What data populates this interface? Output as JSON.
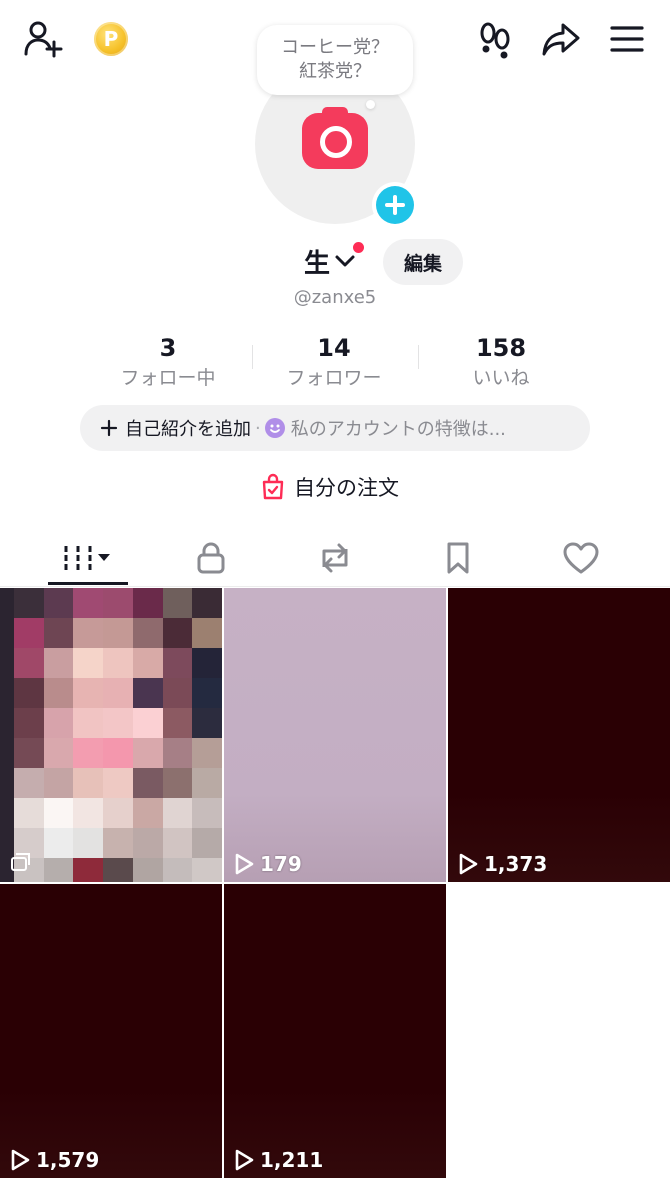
{
  "top_bar": {
    "icons": [
      "add-friend-icon",
      "coin-icon",
      "footprints-icon",
      "share-icon",
      "menu-icon"
    ],
    "coin_letter": "P"
  },
  "bubble": {
    "line1": "コーヒー党？",
    "line2": "紅茶党？"
  },
  "profile": {
    "name": "生",
    "edit_label": "編集",
    "handle": "@zanxe5",
    "accent": "#fe2c55",
    "avatar_add_color": "#20c4e8"
  },
  "stats": [
    {
      "num": "3",
      "label": "フォロー中"
    },
    {
      "num": "14",
      "label": "フォロワー"
    },
    {
      "num": "158",
      "label": "いいね"
    }
  ],
  "bio": {
    "add_label": "自己紹介を追加",
    "sep": "·",
    "hint": "私のアカウントの特徴は..."
  },
  "orders_label": "自分の注文",
  "tabs": [
    "videos",
    "private",
    "reposts",
    "saved",
    "liked"
  ],
  "videos": [
    {
      "views": "",
      "bg": "mosaic"
    },
    {
      "views": "179",
      "bg": "#c6b1c5"
    },
    {
      "views": "1,373",
      "bg": "#2a0004"
    },
    {
      "views": "1,579",
      "bg": "#2a0004"
    },
    {
      "views": "1,211",
      "bg": "#2a0004"
    }
  ]
}
